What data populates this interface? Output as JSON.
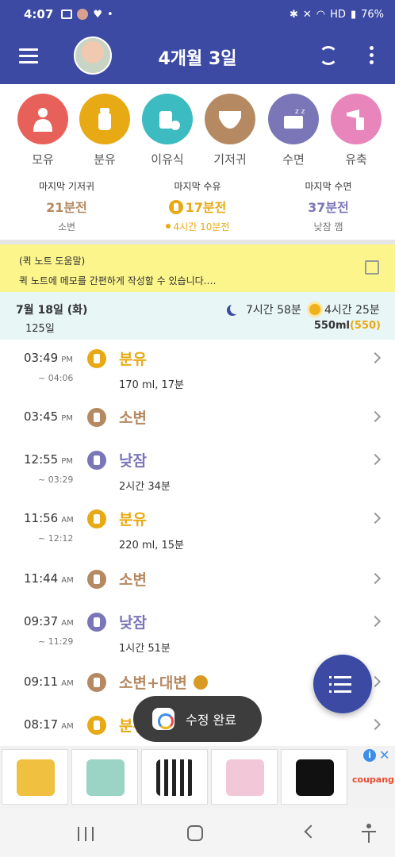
{
  "status_bar": {
    "time": "4:07",
    "battery": "76%",
    "network": "HD"
  },
  "header": {
    "title": "4개월 3일"
  },
  "categories": [
    {
      "label": "모유",
      "icon": "breastfeeding-icon",
      "color": "#e8605a"
    },
    {
      "label": "분유",
      "icon": "bottle-icon",
      "color": "#e8aa14"
    },
    {
      "label": "이유식",
      "icon": "baby-food-icon",
      "color": "#3cbcc0"
    },
    {
      "label": "기저귀",
      "icon": "diaper-icon",
      "color": "#b58a63"
    },
    {
      "label": "수면",
      "icon": "sleep-icon",
      "color": "#7a76b8"
    },
    {
      "label": "유축",
      "icon": "breast-pump-icon",
      "color": "#e886bc"
    }
  ],
  "summary": [
    {
      "title": "마지막 기저귀",
      "value": "21분전",
      "sub": "소변",
      "color": "#b58a63"
    },
    {
      "title": "마지막 수유",
      "value": "17분전",
      "sub": "4시간 10분전",
      "color": "#e8aa14"
    },
    {
      "title": "마지막 수면",
      "value": "37분전",
      "sub": "낮잠 깸",
      "color": "#7a76b8"
    }
  ],
  "quick_note": {
    "title": "(퀵 노트 도움말)",
    "body": "퀵 노트에 메모를 간편하게 작성할 수 있습니다.…"
  },
  "day": {
    "date": "7월 18일 (화)",
    "days": "125일",
    "night_sleep": "7시간 58분",
    "day_sleep": "4시간 25분",
    "volume": "550ml",
    "volume_highlight": "(550)"
  },
  "timeline": [
    {
      "time": "03:49",
      "ampm": "PM",
      "end": "~ 04:06",
      "title": "분유",
      "detail": "170 ml, 17분",
      "kind": "bottle"
    },
    {
      "time": "03:45",
      "ampm": "PM",
      "end": "",
      "title": "소변",
      "detail": "",
      "kind": "diaper"
    },
    {
      "time": "12:55",
      "ampm": "PM",
      "end": "~ 03:29",
      "title": "낮잠",
      "detail": "2시간 34분",
      "kind": "sleep"
    },
    {
      "time": "11:56",
      "ampm": "AM",
      "end": "~ 12:12",
      "title": "분유",
      "detail": "220 ml, 15분",
      "kind": "bottle"
    },
    {
      "time": "11:44",
      "ampm": "AM",
      "end": "",
      "title": "소변",
      "detail": "",
      "kind": "diaper"
    },
    {
      "time": "09:37",
      "ampm": "AM",
      "end": "~ 11:29",
      "title": "낮잠",
      "detail": "1시간 51분",
      "kind": "sleep"
    },
    {
      "time": "09:11",
      "ampm": "AM",
      "end": "",
      "title": "소변+대변",
      "detail": "",
      "kind": "diaper"
    },
    {
      "time": "08:17",
      "ampm": "AM",
      "end": "",
      "title": "분유",
      "detail": "",
      "kind": "bottle"
    }
  ],
  "toast": {
    "label": "수정 완료"
  },
  "ad": {
    "brand": "coupang",
    "info": "i",
    "close": "✕"
  }
}
